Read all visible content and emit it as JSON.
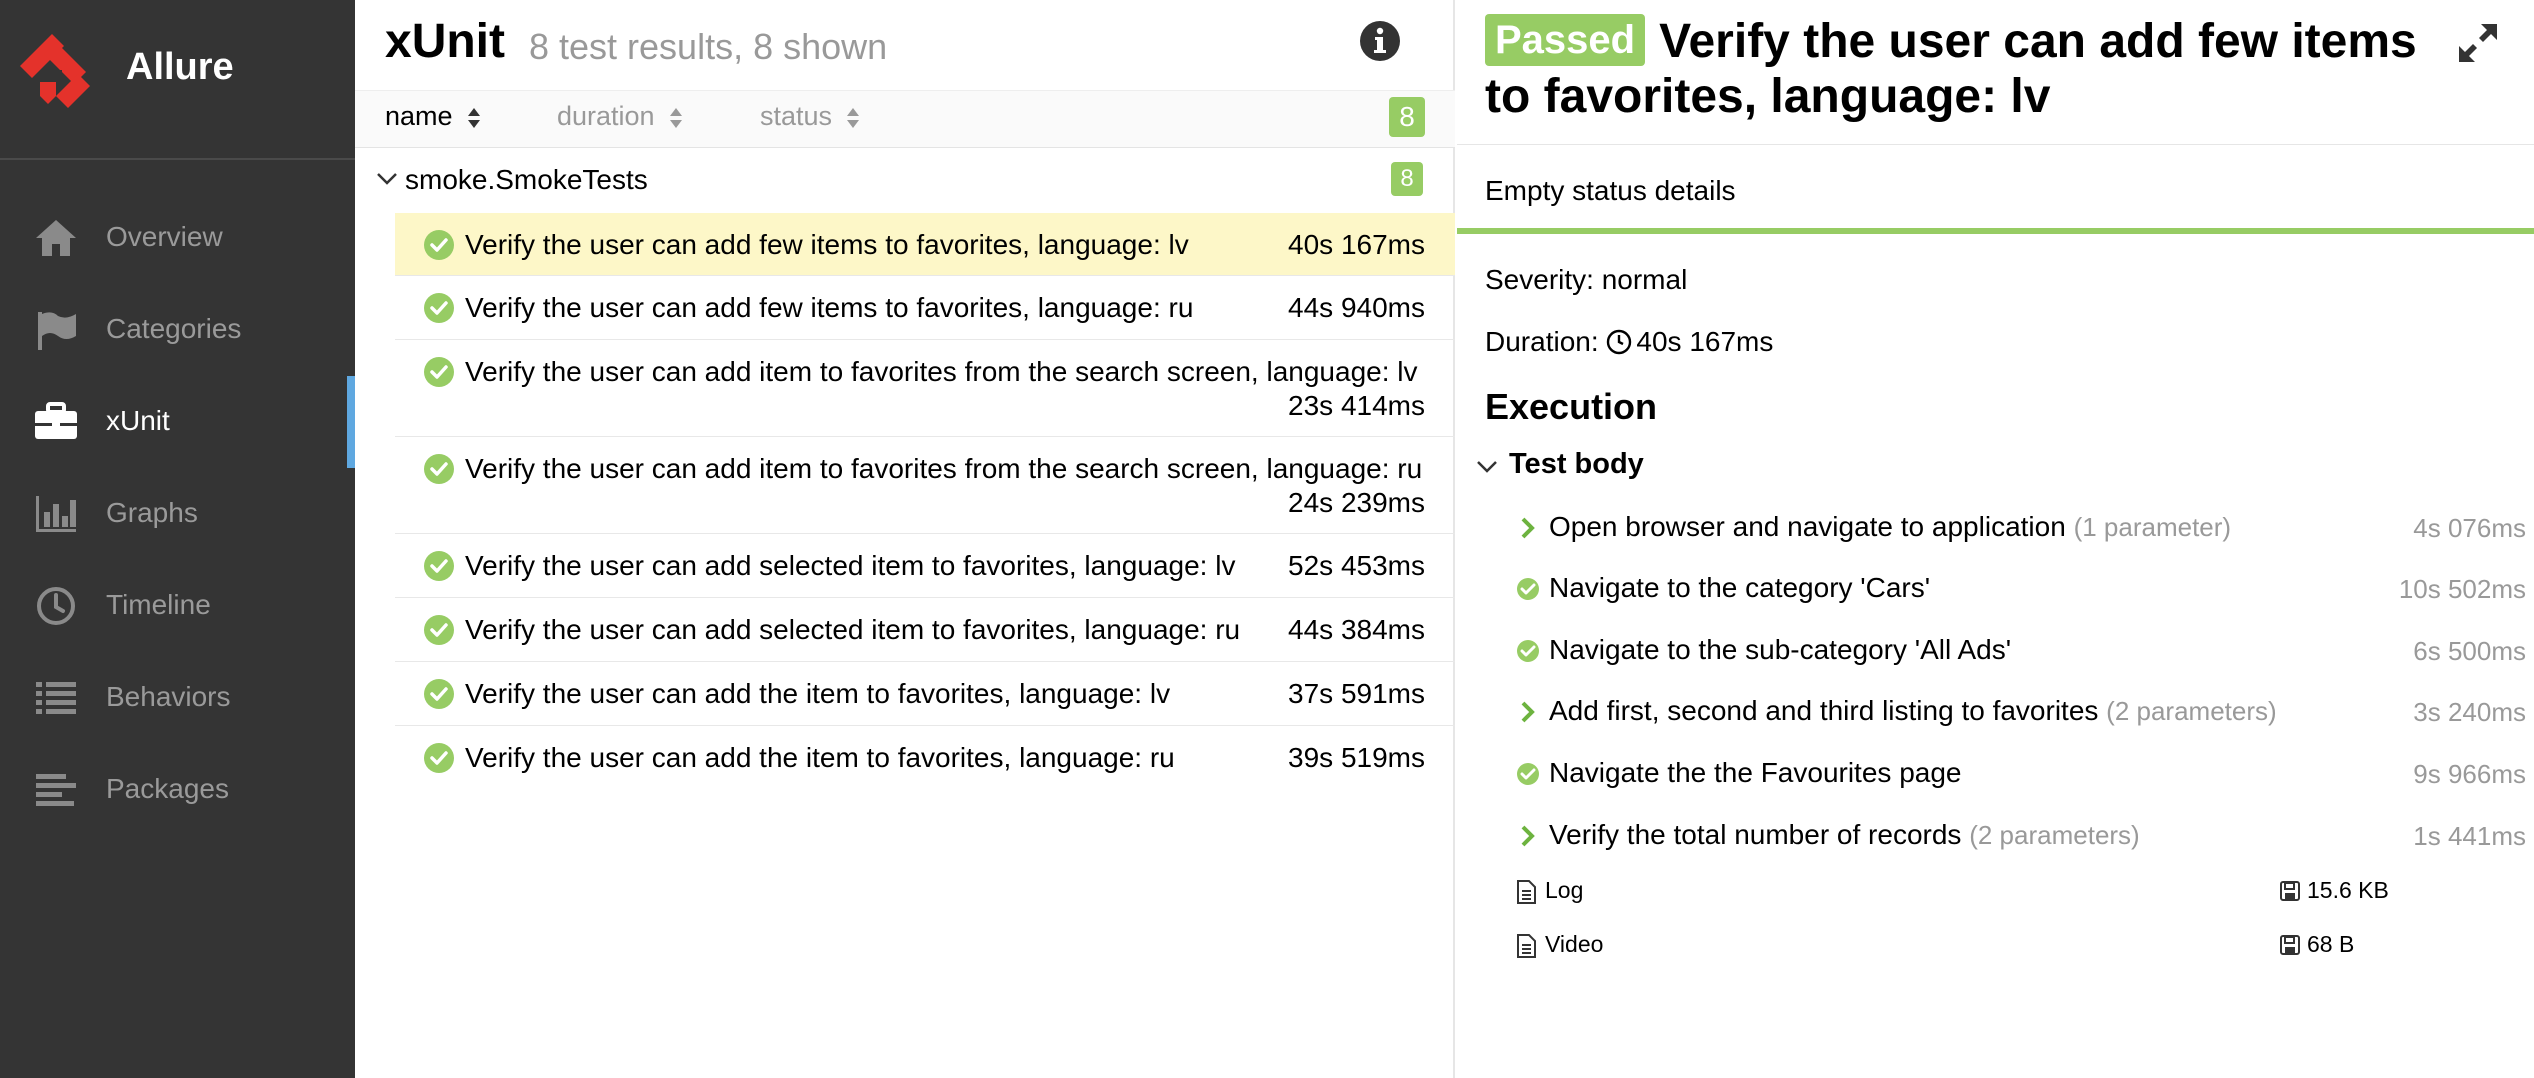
{
  "app": {
    "name": "Allure"
  },
  "sidebar": {
    "items": [
      {
        "label": "Overview",
        "icon": "home-icon"
      },
      {
        "label": "Categories",
        "icon": "flag-icon"
      },
      {
        "label": "xUnit",
        "icon": "briefcase-icon",
        "active": true
      },
      {
        "label": "Graphs",
        "icon": "bar-chart-icon"
      },
      {
        "label": "Timeline",
        "icon": "clock-icon"
      },
      {
        "label": "Behaviors",
        "icon": "list-icon"
      },
      {
        "label": "Packages",
        "icon": "align-left-icon"
      }
    ]
  },
  "list": {
    "title": "xUnit",
    "subtitle": "8 test results, 8 shown",
    "sort": {
      "name": "name",
      "duration": "duration",
      "status": "status"
    },
    "total_count": "8",
    "group": {
      "name": "smoke.SmokeTests",
      "count": "8"
    },
    "tests": [
      {
        "name": "Verify the user can add few items to favorites, language: lv",
        "duration": "40s 167ms",
        "selected": true
      },
      {
        "name": "Verify the user can add few items to favorites, language: ru",
        "duration": "44s 940ms"
      },
      {
        "name": "Verify the user can add item to favorites from the search screen, language: lv",
        "duration": "23s 414ms"
      },
      {
        "name": "Verify the user can add item to favorites from the search screen, language: ru",
        "duration": "24s 239ms"
      },
      {
        "name": "Verify the user can add selected item to favorites, language: lv",
        "duration": "52s 453ms"
      },
      {
        "name": "Verify the user can add selected item to favorites, language: ru",
        "duration": "44s 384ms"
      },
      {
        "name": "Verify the user can add the item to favorites, language: lv",
        "duration": "37s 591ms"
      },
      {
        "name": "Verify the user can add the item to favorites, language: ru",
        "duration": "39s 519ms"
      }
    ]
  },
  "detail": {
    "status": "Passed",
    "title": "Verify the user can add few items to favorites, language: lv",
    "status_details": "Empty status details",
    "severity": "Severity: normal",
    "duration_label": "Duration:",
    "duration": "40s 167ms",
    "execution_title": "Execution",
    "test_body": "Test body",
    "steps": [
      {
        "name": "Open browser and navigate to application",
        "param": "(1 parameter)",
        "duration": "4s 076ms",
        "icon": "chevron-right-icon"
      },
      {
        "name": "Navigate to the category 'Cars'",
        "param": "",
        "duration": "10s 502ms",
        "icon": "check-circle-icon"
      },
      {
        "name": "Navigate to the sub-category 'All Ads'",
        "param": "",
        "duration": "6s 500ms",
        "icon": "check-circle-icon"
      },
      {
        "name": "Add first, second and third listing to favorites",
        "param": "(2 parameters)",
        "duration": "3s 240ms",
        "icon": "chevron-right-icon"
      },
      {
        "name": "Navigate the the Favourites page",
        "param": "",
        "duration": "9s 966ms",
        "icon": "check-circle-icon"
      },
      {
        "name": "Verify the total number of records",
        "param": "(2 parameters)",
        "duration": "1s 441ms",
        "icon": "chevron-right-icon"
      }
    ],
    "attachments": [
      {
        "name": "Log",
        "size": "15.6 KB"
      },
      {
        "name": "Video",
        "size": "68 B"
      }
    ]
  },
  "colors": {
    "passed": "#97cc64",
    "sidebar": "#343434",
    "selected_row": "#fdf7c8",
    "active_marker": "#5fa8e0"
  }
}
